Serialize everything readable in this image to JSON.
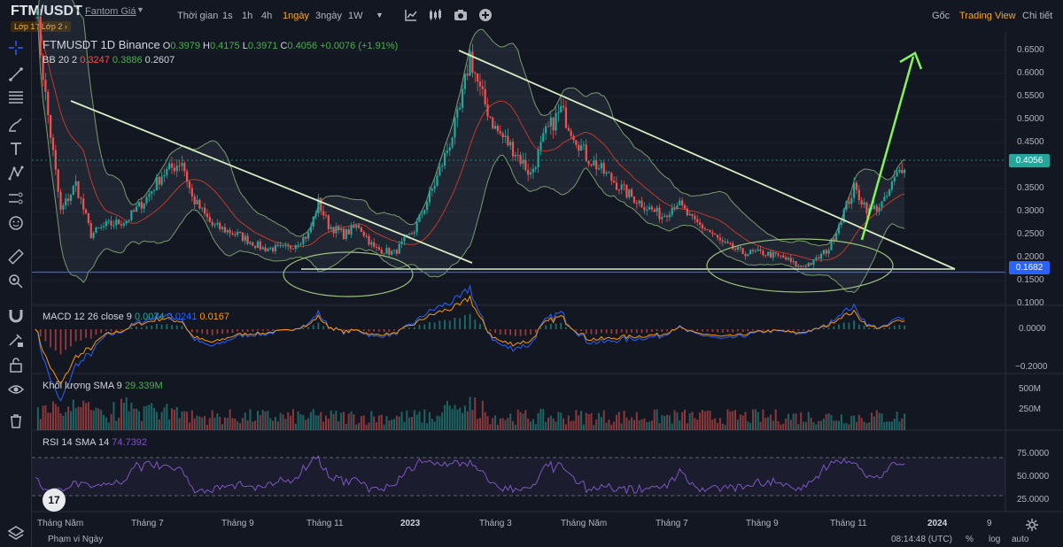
{
  "header": {
    "symbol": "FTM/USDT",
    "symbol_sub": "Fantom Giá",
    "layer_badge": "Lớp 1 / Lớp 2 ›",
    "timeframes": [
      {
        "label": "Thời gian",
        "active": false
      },
      {
        "label": "1s",
        "active": false
      },
      {
        "label": "1h",
        "active": false
      },
      {
        "label": "4h",
        "active": false
      },
      {
        "label": "1ngày",
        "active": true
      },
      {
        "label": "3ngày",
        "active": false
      },
      {
        "label": "1W",
        "active": false
      }
    ],
    "right_items": [
      {
        "label": "Gốc",
        "active": false
      },
      {
        "label": "Trading View",
        "active": true
      },
      {
        "label": "Chi tiết",
        "active": false
      }
    ]
  },
  "legend": {
    "title": "FTMUSDT  1D  Binance",
    "ohlc": [
      {
        "k": "O",
        "v": "0.3979"
      },
      {
        "k": "H",
        "v": "0.4175"
      },
      {
        "k": "L",
        "v": "0.3971"
      },
      {
        "k": "C",
        "v": "0.4056"
      }
    ],
    "change": "+0.0076 (+1.91%)",
    "bb_label": "BB 20 2",
    "bb_values": [
      "0.3247",
      "0.3886",
      "0.2607"
    ],
    "macd_label": "MACD 12 26 close 9",
    "macd_values": [
      "0.0074",
      "0.0241",
      "0.0167"
    ],
    "volume_label": "Khối lượng SMA 9",
    "volume_value": "29.339M",
    "rsi_label": "RSI 14 SMA 14",
    "rsi_value": "74.7392"
  },
  "price_axis": [
    "0.6500",
    "0.6000",
    "0.5500",
    "0.5000",
    "0.4500",
    "0.4000",
    "0.3500",
    "0.3000",
    "0.2500",
    "0.2000",
    "0.1500",
    "0.1000"
  ],
  "price_tags": {
    "current": "0.4056",
    "support": "0.1682"
  },
  "macd_axis": [
    "0.0000",
    "−0.2000"
  ],
  "volume_axis": [
    "500M",
    "250M"
  ],
  "rsi_axis": [
    "75.0000",
    "50.0000",
    "25.0000"
  ],
  "time_axis": [
    {
      "label": "Tháng Năm",
      "bold": false
    },
    {
      "label": "Tháng 7",
      "bold": false
    },
    {
      "label": "Tháng 9",
      "bold": false
    },
    {
      "label": "Tháng 11",
      "bold": false
    },
    {
      "label": "2023",
      "bold": true
    },
    {
      "label": "Tháng 3",
      "bold": false
    },
    {
      "label": "Tháng Năm",
      "bold": false
    },
    {
      "label": "Tháng 7",
      "bold": false
    },
    {
      "label": "Tháng 9",
      "bold": false
    },
    {
      "label": "Tháng 11",
      "bold": false
    },
    {
      "label": "2024",
      "bold": true
    },
    {
      "label": "9",
      "bold": false
    }
  ],
  "footer": {
    "range_label": "Phạm vi Ngày",
    "clock": "08:14:48 (UTC)",
    "percent": "%",
    "log": "log",
    "auto": "auto"
  },
  "colors": {
    "up": "#26a69a",
    "down": "#ef5350",
    "bb_band": "#7a9a6a",
    "bb_mid": "#c0392b",
    "trendline": "#d8ecc4",
    "arrow": "#86f25c",
    "support": "#2962ff",
    "rsi": "#7e57c2",
    "accent": "#f5a623"
  },
  "icons": {
    "toolbar": [
      "crosshair-icon",
      "trendline-icon",
      "fib-icon",
      "brush-icon",
      "text-icon",
      "pattern-icon",
      "prediction-icon",
      "emoji-icon",
      "ruler-icon",
      "zoom-icon",
      "magnet-icon",
      "lock-drawings-icon",
      "lock-icon",
      "eye-icon",
      "trash-icon"
    ]
  }
}
